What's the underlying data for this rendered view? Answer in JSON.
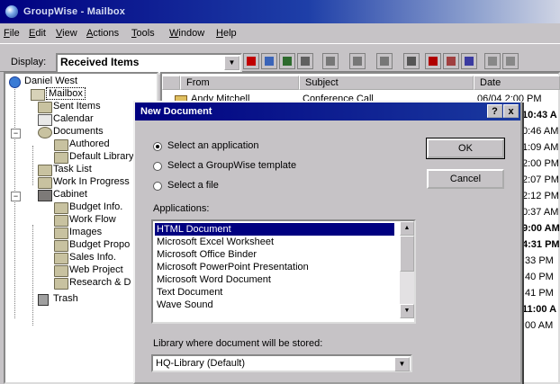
{
  "window": {
    "title": "GroupWise - Mailbox"
  },
  "menu": [
    {
      "label": "File",
      "u": "F",
      "rest": "ile"
    },
    {
      "label": "Edit",
      "u": "E",
      "rest": "dit"
    },
    {
      "label": "View",
      "u": "V",
      "rest": "iew"
    },
    {
      "label": "Actions",
      "u": "A",
      "rest": "ctions"
    },
    {
      "label": "Tools",
      "u": "T",
      "rest": "ools"
    },
    {
      "label": "Window",
      "u": "W",
      "rest": "indow"
    },
    {
      "label": "Help",
      "u": "H",
      "rest": "elp"
    }
  ],
  "toolbar": {
    "display_label": "Display:",
    "display_value": "Received Items"
  },
  "tree": {
    "items": [
      {
        "label": "Daniel West",
        "icon": "user-icon"
      },
      {
        "label": "Mailbox",
        "icon": "mailbox-icon"
      },
      {
        "label": "Sent Items",
        "icon": "folder-icon"
      },
      {
        "label": "Calendar",
        "icon": "calendar-icon"
      },
      {
        "label": "Documents",
        "icon": "documents-icon"
      },
      {
        "label": "Authored",
        "icon": "folder-icon"
      },
      {
        "label": "Default Library",
        "icon": "folder-icon"
      },
      {
        "label": "Task List",
        "icon": "folder-icon"
      },
      {
        "label": "Work In Progress",
        "icon": "folder-icon"
      },
      {
        "label": "Cabinet",
        "icon": "cabinet-icon"
      },
      {
        "label": "Budget Info.",
        "icon": "folder-icon"
      },
      {
        "label": "Work Flow",
        "icon": "folder-icon"
      },
      {
        "label": "Images",
        "icon": "folder-icon"
      },
      {
        "label": "Budget Propo",
        "icon": "folder-icon"
      },
      {
        "label": "Sales Info.",
        "icon": "folder-icon"
      },
      {
        "label": "Web Project",
        "icon": "folder-icon"
      },
      {
        "label": "Research & D",
        "icon": "folder-icon"
      },
      {
        "label": "Trash",
        "icon": "trash-icon"
      }
    ]
  },
  "list": {
    "columns": {
      "from": "From",
      "subject": "Subject",
      "date": "Date"
    },
    "first_row": {
      "from": "Andy Mitchell",
      "subject": "Conference Call",
      "date": "06/04 2:00 PM"
    },
    "times": [
      "10:43 A",
      "0:46 AM",
      "1:09 AM",
      "2:00 PM",
      "2:07 PM",
      "2:12 PM",
      "0:37 AM",
      "9:00 AM",
      "4:31 PM",
      ":33 PM",
      ":40 PM",
      ":41 PM",
      "11:00 A",
      ":00 AM"
    ]
  },
  "dialog": {
    "title": "New Document",
    "help_btn": "?",
    "close_btn": "x",
    "options": [
      {
        "label": "Select an application",
        "checked": true
      },
      {
        "label": "Select a GroupWise template",
        "checked": false
      },
      {
        "label": "Select a file",
        "checked": false
      }
    ],
    "ok": "OK",
    "cancel": "Cancel",
    "applications_label": "Applications:",
    "applications": [
      "HTML Document",
      "Microsoft Excel Worksheet",
      "Microsoft Office Binder",
      "Microsoft PowerPoint Presentation",
      "Microsoft Word Document",
      "Text Document",
      "Wave Sound"
    ],
    "selected_index": 0,
    "library_label": "Library where document will be stored:",
    "library_value": "HQ-Library (Default)"
  },
  "colors": {
    "titlebar": "#000080",
    "face": "#c6c3c6",
    "selection": "#000080"
  }
}
